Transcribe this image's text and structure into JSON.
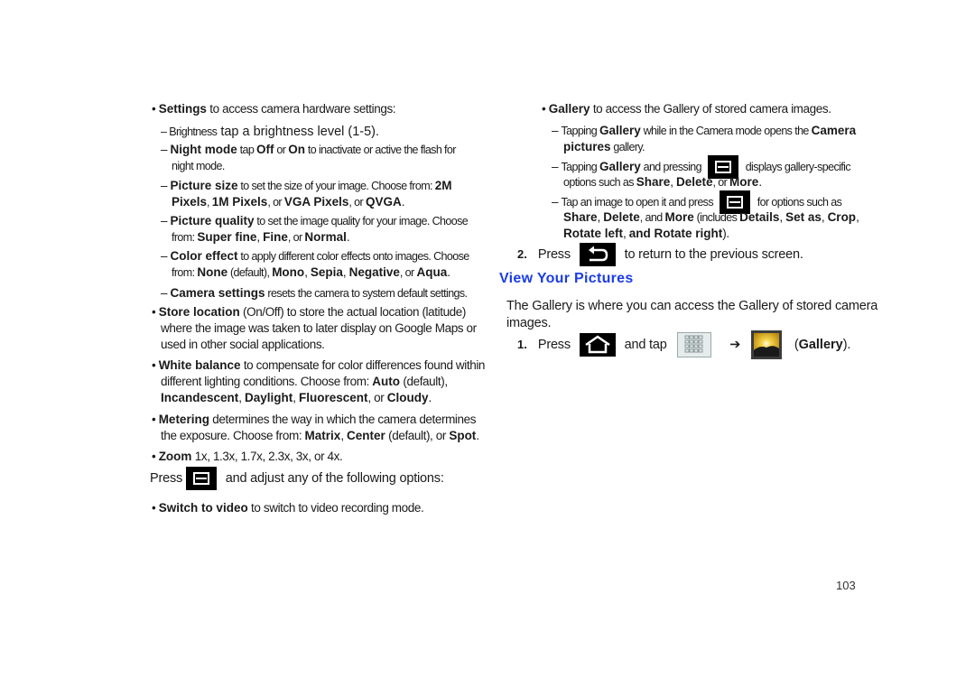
{
  "left": {
    "settings": {
      "bold": "Settings",
      "text": " to access camera hardware settings:"
    },
    "brightness": {
      "label": "Brightness",
      "text": " tap a brightness level (1-5)."
    },
    "night_mode": {
      "bold": "Night mode",
      "t1": " tap ",
      "b1": "Off",
      "t2": " or ",
      "b2": "On",
      "t3": " to inactivate or active the flash for",
      "line2": "night mode."
    },
    "picture_size": {
      "bold": "Picture size",
      "t1": " to set the size of your image. Choose from: ",
      "b1": "2M",
      "b2": "Pixels",
      "t2": ", ",
      "b3": "1M Pixels",
      "t3": ", or ",
      "b4": "VGA Pixels",
      "t4": ", or ",
      "b5": "QVGA",
      "t5": "."
    },
    "picture_quality": {
      "bold": "Picture quality",
      "t1": " to set the image quality for your image. Choose",
      "t2": "from: ",
      "b1": "Super fine",
      "t3": ", ",
      "b2": "Fine",
      "t4": ", or ",
      "b3": "Normal",
      "t5": "."
    },
    "color_effect": {
      "bold": "Color effect",
      "t1": " to apply different color effects onto images. Choose",
      "t2": "from: ",
      "b1": "None",
      "t3": " (default), ",
      "b2": "Mono",
      "t4": ", ",
      "b3": "Sepia",
      "t5": ", ",
      "b4": "Negative",
      "t6": ", or ",
      "b5": "Aqua",
      "t7": "."
    },
    "camera_settings": {
      "bold": "Camera settings",
      "text": " resets the camera to system default settings."
    },
    "store_location": {
      "bold": "Store location",
      "t1": " (On/Off) to store the actual location (latitude)",
      "line2": "where the image was taken to later display on Google Maps or",
      "line3": "used in other social applications."
    },
    "white_balance": {
      "bold": "White balance",
      "t1": " to compensate for color differences found within",
      "t2": "different lighting conditions. Choose from: ",
      "b1": "Auto",
      "t3": " (default),",
      "b2": "Incandescent",
      "t4": ", ",
      "b3": "Daylight",
      "t5": ", ",
      "b4": "Fluorescent",
      "t6": ", or ",
      "b5": "Cloudy",
      "t7": "."
    },
    "metering": {
      "bold": "Metering",
      "t1": " determines the way in which the camera determines",
      "t2": "the exposure. Choose from: ",
      "b1": "Matrix",
      "t3": ", ",
      "b2": "Center",
      "t4": " (default), or ",
      "b3": "Spot",
      "t5": "."
    },
    "zoom": {
      "bold": "Zoom",
      "text": " 1x, 1.3x, 1.7x, 2.3x, 3x, or 4x."
    },
    "press_menu": {
      "t1": "Press",
      "t2": "and adjust any of the following options:"
    },
    "switch_video": {
      "bold": "Switch to video",
      "text": " to switch to video recording mode."
    }
  },
  "right": {
    "gallery": {
      "bold": "Gallery",
      "text": " to access the Gallery of stored camera images."
    },
    "tapping1": {
      "t1": "Tapping ",
      "b1": "Gallery",
      "t2": " while in the Camera mode opens the ",
      "b2": "Camera",
      "b3": "pictures",
      "t3": " gallery."
    },
    "tapping2": {
      "t1": "Tapping ",
      "b1": "Gallery",
      "t2": " and pressing",
      "t3": "displays gallery-specific",
      "t4": "options such as ",
      "b2": "Share",
      "t5": ", ",
      "b3": "Delete",
      "t6": ", or ",
      "b4": "More",
      "t7": "."
    },
    "tap_image": {
      "t1": "Tap an image to open it and press",
      "t2": "for options such as",
      "b1": "Share",
      "t3": ", ",
      "b2": "Delete",
      "t4": ", and ",
      "b3": "More",
      "t5": " (includes ",
      "b4": "Details",
      "t6": ", ",
      "b5": "Set as",
      "t7": ", ",
      "b6": "Crop",
      "t8": ",",
      "b7": "Rotate left",
      "t9": ", ",
      "b8": "and Rotate right",
      "t10": ")."
    },
    "step2": {
      "num": "2.",
      "t1": "Press",
      "t2": "to return to the previous screen."
    },
    "heading": "View Your Pictures",
    "intro": {
      "line1": "The Gallery is where you can access the Gallery of stored camera",
      "line2": "images."
    },
    "step1": {
      "num": "1.",
      "t1": "Press",
      "t2": "and tap",
      "arrow": "➔",
      "t3": "(",
      "b1": "Gallery",
      "t4": ")."
    }
  },
  "page_number": "103",
  "colors": {
    "heading": "#1a3ce8",
    "text": "#1a1a1a"
  }
}
